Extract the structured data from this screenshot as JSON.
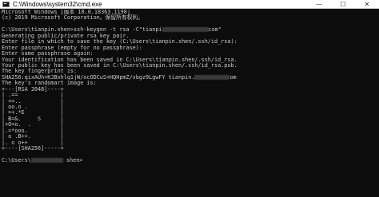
{
  "window": {
    "title": "C:\\Windows\\system32\\cmd.exe",
    "buttons": {
      "minimize": "—",
      "maximize": "☐",
      "close": "✕"
    }
  },
  "console": {
    "lines": [
      {
        "text": "Microsoft Windows [版本 10.0.18363.1198]"
      },
      {
        "text": "(c) 2019 Microsoft Corporation。保留所有权利。"
      },
      {
        "text": ""
      },
      {
        "text": "C:\\Users\\tianpin.shen>ssh-keygen -t rsa -C\"tianpi",
        "redact_width": 58,
        "after": "com\""
      },
      {
        "text": "Generating public/private rsa key pair."
      },
      {
        "text": "Enter file in which to save the key (C:\\Users\\tianpin.shen/.ssh/id_rsa):"
      },
      {
        "text": "Enter passphrase (empty for no passphrase):"
      },
      {
        "text": "Enter same passphrase again:"
      },
      {
        "text": "Your identification has been saved in C:\\Users\\tianpin.shen/.ssh/id_rsa."
      },
      {
        "text": "Your public key has been saved in C:\\Users\\tianpin.shen/.ssh/id_rsa.pub."
      },
      {
        "text": "The key fingerprint is:"
      },
      {
        "text": "SHA256:qixAUh+KJBxhlq1jW/ocODCuS+HQHpmZ/vbgz9LgwFY tianpin.",
        "redact_width": 44,
        "after": "om"
      },
      {
        "text": "The key's randomart image is:"
      },
      {
        "text": "+---[RSA 2048]----+"
      },
      {
        "text": "| .==             |"
      },
      {
        "text": "| +=..            |"
      },
      {
        "text": "| oo.o .          |"
      },
      {
        "text": "| =+.*E           |"
      },
      {
        "text": "| B=&.     S      |"
      },
      {
        "text": "|+O=o.  .         |"
      },
      {
        "text": "|.=*ooo.          |"
      },
      {
        "text": "| o .B++.         |"
      },
      {
        "text": "|. o o++          |"
      },
      {
        "text": "+----[SHA256]-----+"
      },
      {
        "text": ""
      },
      {
        "text": "C:\\Users\\",
        "redact_width": 40,
        "after": " shen>"
      }
    ]
  }
}
